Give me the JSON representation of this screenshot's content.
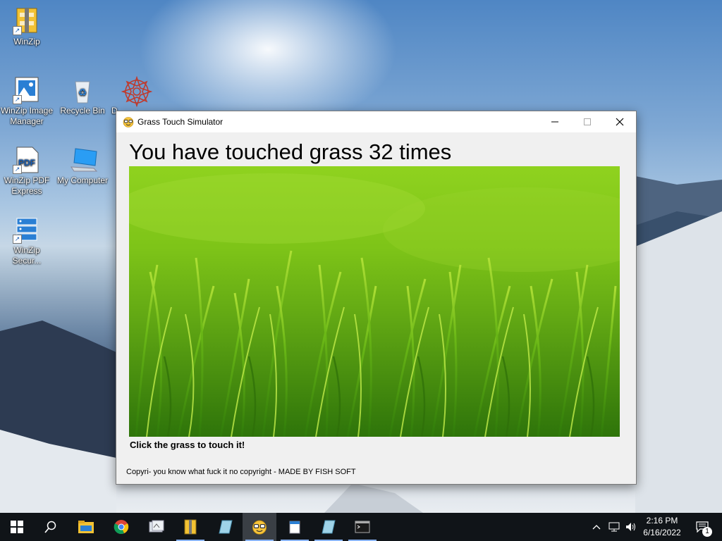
{
  "desktop": {
    "icons": [
      {
        "label": "WinZip",
        "icon": "winzip-icon"
      },
      {
        "label": "WinZip Image Manager",
        "icon": "image-manager-icon"
      },
      {
        "label": "Recycle Bin",
        "icon": "recycle-bin-icon"
      },
      {
        "label": "D",
        "icon": "mandala-icon"
      },
      {
        "label": "WinZip PDF Express",
        "icon": "pdf-icon"
      },
      {
        "label": "My Computer",
        "icon": "computer-icon"
      },
      {
        "label": "WinZip Secur...",
        "icon": "secure-icon"
      }
    ]
  },
  "window": {
    "title": "Grass Touch Simulator",
    "heading": "You have touched grass 32 times",
    "hint": "Click the grass to touch it!",
    "copyright": "Copyri- you know what fuck it no copyright - MADE BY FISH SOFT",
    "controls": {
      "minimize": "minimize-icon",
      "maximize": "maximize-icon",
      "close": "close-icon"
    }
  },
  "taskbar": {
    "items": [
      "start-icon",
      "search-icon",
      "file-explorer-icon",
      "chrome-icon",
      "app-icon",
      "winzip-icon",
      "app2-icon",
      "grass-touch-simulator-icon",
      "notepad-icon",
      "app3-icon",
      "cmd-icon"
    ],
    "active_item": "grass-touch-simulator-icon",
    "time": "2:16 PM",
    "date": "6/16/2022",
    "notification_count": "1"
  }
}
